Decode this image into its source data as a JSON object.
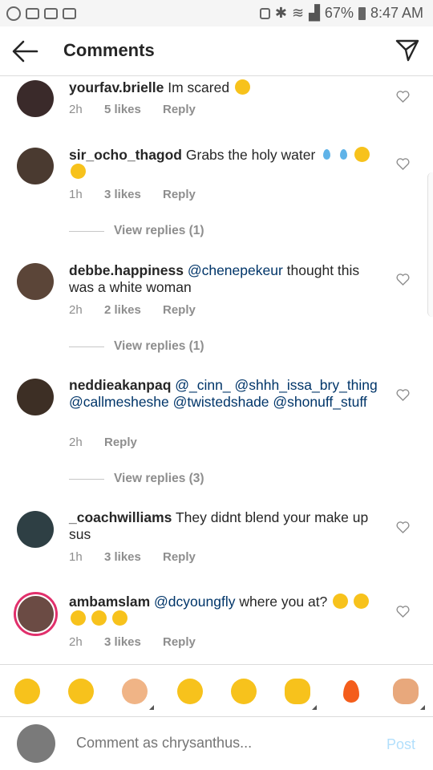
{
  "status_bar": {
    "battery": "67%",
    "time": "8:47 AM"
  },
  "header": {
    "title": "Comments"
  },
  "comments": [
    {
      "username": "yourfav.brielle",
      "text": "Im scared",
      "time": "2h",
      "likes": "5 likes",
      "reply": "Reply"
    },
    {
      "username": "sir_ocho_thagod",
      "text": "Grabs the holy water",
      "time": "1h",
      "likes": "3 likes",
      "reply": "Reply",
      "view_replies": "View replies (1)"
    },
    {
      "username": "debbe.happiness",
      "mention": "@chenepekeur",
      "text": "thought this was a white woman",
      "time": "2h",
      "likes": "2 likes",
      "reply": "Reply",
      "view_replies": "View replies (1)"
    },
    {
      "username": "neddieakanpaq",
      "mentions": "@_cinn_ @shhh_issa_bry_thing @callmesheshe @twistedshade @shonuff_stuff",
      "time": "2h",
      "reply": "Reply",
      "view_replies": "View replies (3)"
    },
    {
      "username": "_coachwilliams",
      "text": "They didnt blend your make up sus",
      "time": "1h",
      "likes": "3 likes",
      "reply": "Reply"
    },
    {
      "username": "ambamslam",
      "mention": "@dcyoungfly",
      "text": "where you at?",
      "time": "2h",
      "likes": "3 likes",
      "reply": "Reply"
    }
  ],
  "emoji_bar": [
    "joy-emoji",
    "rofl-emoji",
    "boy-emoji",
    "grin-emoji",
    "woozy-emoji",
    "ok-hand-emoji",
    "fire-emoji",
    "fist-emoji"
  ],
  "composer": {
    "placeholder": "Comment as chrysanthus...",
    "post_label": "Post"
  }
}
